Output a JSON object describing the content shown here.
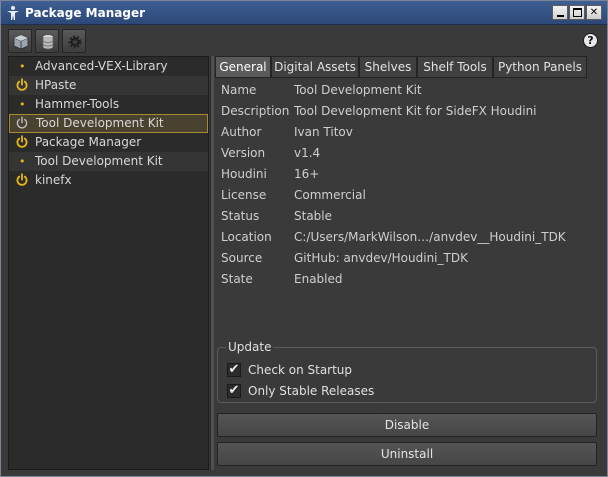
{
  "window": {
    "title": "Package Manager",
    "icon": "houdini-figure-icon"
  },
  "toolbar": {
    "buttons": [
      {
        "icon": "package-cube-icon"
      },
      {
        "icon": "database-icon"
      },
      {
        "icon": "gear-icon"
      }
    ],
    "help_label": "?"
  },
  "packages": [
    {
      "label": "Advanced-VEX-Library",
      "icon": "dot",
      "mark": "•"
    },
    {
      "label": "HPaste",
      "icon": "power"
    },
    {
      "label": "Hammer-Tools",
      "icon": "dot",
      "mark": "•"
    },
    {
      "label": "Tool Development Kit",
      "icon": "power",
      "selected": true
    },
    {
      "label": "Package Manager",
      "icon": "power"
    },
    {
      "label": "Tool Development Kit",
      "icon": "dot",
      "mark": "•"
    },
    {
      "label": "kinefx",
      "icon": "power"
    }
  ],
  "tabs": [
    "General",
    "Digital Assets",
    "Shelves",
    "Shelf Tools",
    "Python Panels"
  ],
  "details": [
    {
      "label": "Name",
      "value": "Tool Development Kit"
    },
    {
      "label": "Description",
      "value": "Tool Development Kit for SideFX Houdini"
    },
    {
      "label": "Author",
      "value": "Ivan Titov"
    },
    {
      "label": "Version",
      "value": "v1.4"
    },
    {
      "label": "Houdini",
      "value": "16+"
    },
    {
      "label": "License",
      "value": "Commercial"
    },
    {
      "label": "Status",
      "value": "Stable"
    },
    {
      "label": "Location",
      "value": "C:/Users/MarkWilson…/anvdev__Houdini_TDK"
    },
    {
      "label": "Source",
      "value": "GitHub: anvdev/Houdini_TDK"
    },
    {
      "label": "State",
      "value": "Enabled"
    }
  ],
  "update": {
    "title": "Update",
    "check_on_startup": {
      "label": "Check on Startup",
      "checked": true
    },
    "only_stable": {
      "label": "Only Stable Releases",
      "checked": true
    },
    "check_mark": "✔"
  },
  "actions": {
    "disable": "Disable",
    "uninstall": "Uninstall"
  },
  "colors": {
    "accent": "#e6b619",
    "selection": "#a98a30"
  }
}
